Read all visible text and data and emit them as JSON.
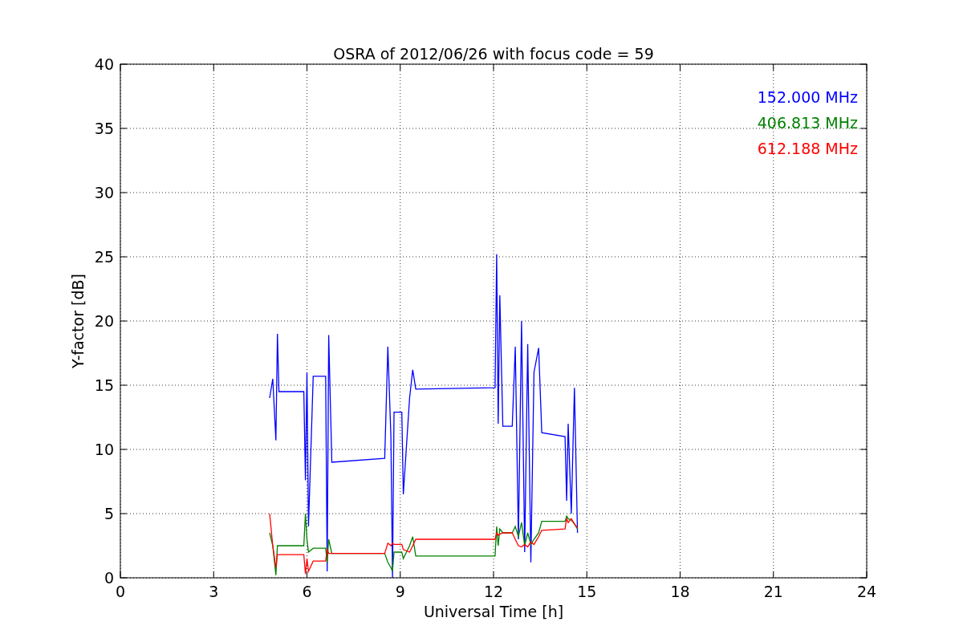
{
  "figure": {
    "chart_data": {
      "type": "line",
      "title": "OSRA of 2012/06/26 with focus code = 59",
      "xlabel": "Universal Time [h]",
      "ylabel": "Y-factor [dB]",
      "x": [
        4.8,
        4.9,
        5.0,
        5.05,
        5.1,
        5.9,
        5.95,
        6.0,
        6.05,
        6.2,
        6.6,
        6.65,
        6.7,
        6.8,
        8.5,
        8.6,
        8.7,
        8.75,
        8.8,
        9.05,
        9.1,
        9.3,
        9.4,
        9.5,
        12.05,
        12.1,
        12.15,
        12.2,
        12.3,
        12.6,
        12.7,
        12.8,
        12.9,
        13.0,
        13.1,
        13.2,
        13.3,
        13.45,
        13.55,
        14.3,
        14.35,
        14.4,
        14.5,
        14.6,
        14.7
      ],
      "series": [
        {
          "name": "152.000 MHz",
          "color": "#0000ff",
          "values": [
            14,
            15.5,
            10.7,
            19,
            14.5,
            14.5,
            7.6,
            16,
            4,
            15.7,
            15.7,
            0.5,
            18.9,
            9,
            9.3,
            18,
            11,
            0,
            12.9,
            12.9,
            6.5,
            14,
            16.2,
            14.7,
            14.8,
            25.2,
            12,
            22,
            11.8,
            11.8,
            18,
            3,
            20,
            2,
            18.2,
            1.2,
            16,
            17.9,
            11.3,
            11,
            6,
            12,
            5,
            14.8,
            3.5
          ]
        },
        {
          "name": "406.813 MHz",
          "color": "#008000",
          "values": [
            3.5,
            2.5,
            0.2,
            2.5,
            2.5,
            2.5,
            5,
            3,
            2,
            2.3,
            2.3,
            1.2,
            3,
            1.9,
            1.9,
            1.2,
            0.8,
            0.5,
            2,
            2,
            1.5,
            2.5,
            3.2,
            1.7,
            1.7,
            4,
            2.5,
            3.8,
            3.5,
            3.5,
            4,
            3.2,
            4.3,
            2.5,
            3.5,
            2.6,
            3,
            3.5,
            4.4,
            4.4,
            4.8,
            4.6,
            4.5,
            4.2,
            3.8
          ]
        },
        {
          "name": "612.188 MHz",
          "color": "#ff0000",
          "values": [
            5,
            2.5,
            0.8,
            1.8,
            1.8,
            1.8,
            0.3,
            1.5,
            0.5,
            1.3,
            1.3,
            2.2,
            1.9,
            1.9,
            1.9,
            2.7,
            2.5,
            2.7,
            2.6,
            2.6,
            2.2,
            2,
            2.5,
            3,
            3,
            3.5,
            3.3,
            3.4,
            3.5,
            3.5,
            3,
            2.5,
            2.4,
            2.6,
            2.4,
            2.8,
            2.6,
            3.2,
            3.7,
            3.8,
            4.6,
            4.3,
            4.6,
            4.2,
            3.9
          ]
        }
      ],
      "grid": true,
      "xlim": [
        0,
        24
      ],
      "ylim": [
        0,
        40
      ],
      "xticks": [
        0,
        3,
        6,
        9,
        12,
        15,
        18,
        21,
        24
      ],
      "yticks": [
        0,
        5,
        10,
        15,
        20,
        25,
        30,
        35,
        40
      ]
    }
  }
}
